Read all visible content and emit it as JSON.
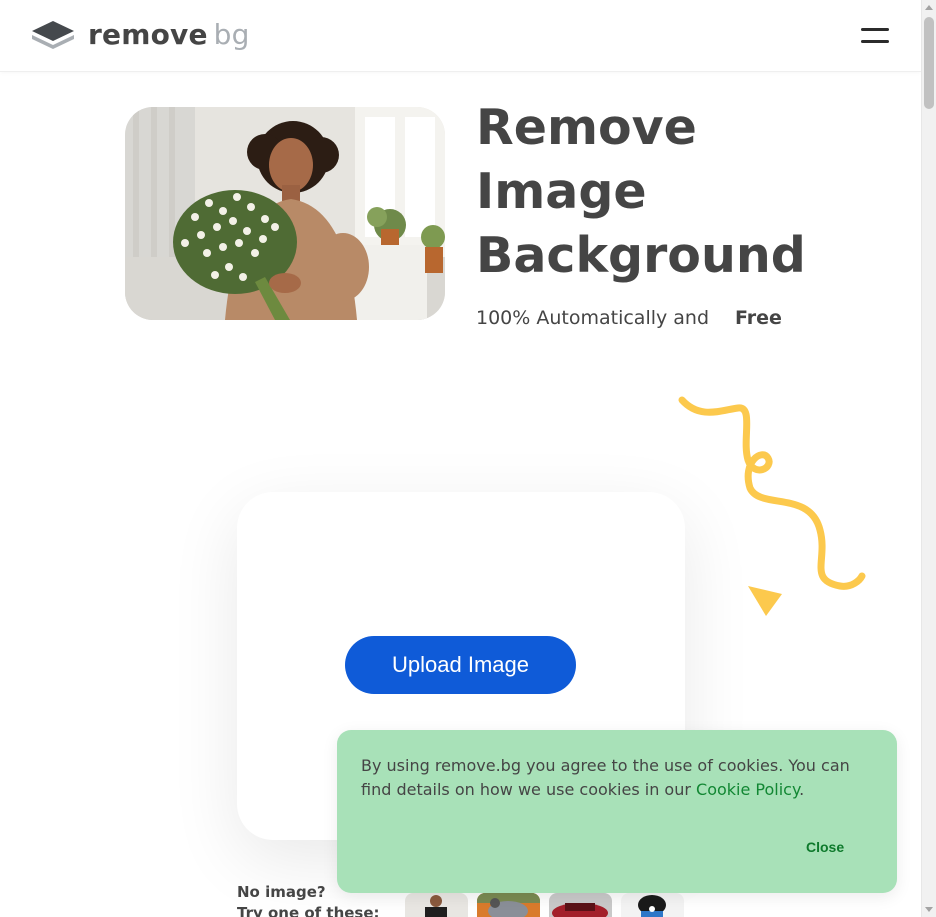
{
  "brand": {
    "logo_word1": "remove",
    "logo_word2": "bg",
    "accent": "#0f5bd8",
    "highlight": "#fcd25b",
    "cookie_bg": "#a8e1b8"
  },
  "header": {
    "menu_icon": "hamburger-menu-icon"
  },
  "hero": {
    "title_lines": [
      "Remove",
      "Image",
      "Background"
    ],
    "subtitle": "100% Automatically and",
    "free_badge": "Free"
  },
  "upload": {
    "button_label": "Upload Image"
  },
  "samples": {
    "line1": "No image?",
    "line2": "Try one of these:",
    "thumbnails": [
      "sample-woman",
      "sample-bird",
      "sample-car",
      "sample-game-controller"
    ]
  },
  "cookie": {
    "text_before": "By using remove.bg you agree to the use of cookies. You can find details on how we use cookies in our ",
    "link_text": "Cookie Policy",
    "text_after": ".",
    "close_label": "Close"
  }
}
